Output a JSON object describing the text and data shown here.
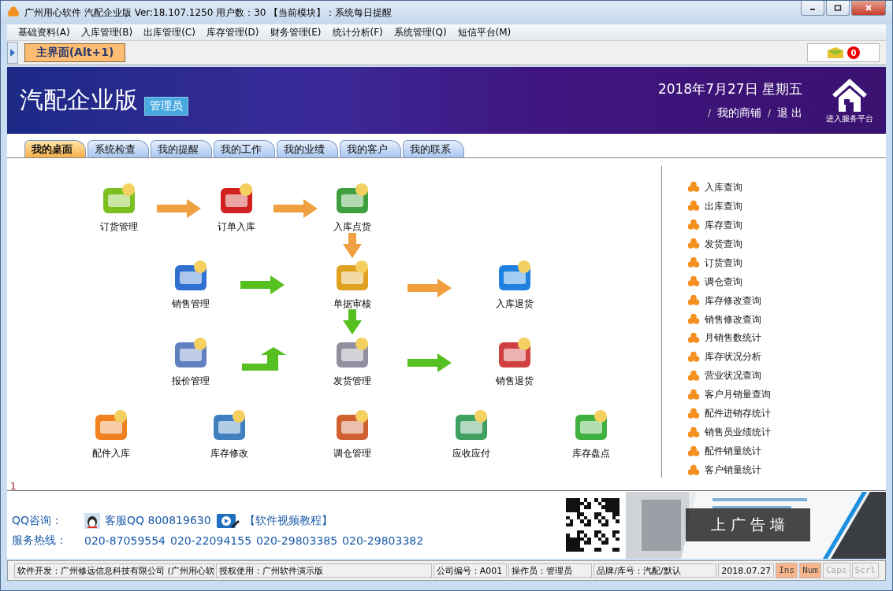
{
  "window": {
    "title": "广州用心软件 汽配企业版  Ver:18.107.1250  用户数：30  【当前模块】：系统每日提醒"
  },
  "menu": [
    "基础资料(A)",
    "入库管理(B)",
    "出库管理(C)",
    "库存管理(D)",
    "财务管理(E)",
    "统计分析(F)",
    "系统管理(Q)",
    "短信平台(M)"
  ],
  "toolbar": {
    "tab": "主界面(Alt+1)",
    "badge": "0"
  },
  "banner": {
    "title": "汽配企业版",
    "role": "管理员",
    "date": "2018年7月27日 星期五",
    "links": [
      "我的商铺",
      "退 出"
    ],
    "service": "进入服务平台"
  },
  "tabs": [
    {
      "label": "我的桌面",
      "selected": true
    },
    {
      "label": "系统检查",
      "selected": false
    },
    {
      "label": "我的提醒",
      "selected": false
    },
    {
      "label": "我的工作",
      "selected": false
    },
    {
      "label": "我的业绩",
      "selected": false
    },
    {
      "label": "我的客户",
      "selected": false
    },
    {
      "label": "我的联系",
      "selected": false
    }
  ],
  "flow": [
    "订货管理",
    "订单入库",
    "入库点货",
    "销售管理",
    "单据审核",
    "入库退货",
    "报价管理",
    "发货管理",
    "销售退货",
    "配件入库",
    "库存修改",
    "调仓管理",
    "应收应付",
    "库存盘点"
  ],
  "quick_links": [
    "入库查询",
    "出库查询",
    "库存查询",
    "发货查询",
    "订货查询",
    "调仓查询",
    "库存修改查询",
    "销售修改查询",
    "月销售数统计",
    "库存状况分析",
    "营业状况查询",
    "客户月销量查询",
    "配件进销存统计",
    "销售员业绩统计",
    "配件销量统计",
    "客户销量统计"
  ],
  "page_marker": "1",
  "contact": {
    "qq_label": "QQ咨询：",
    "qq": "客服QQ 800819630",
    "video": "【软件视频教程】",
    "hotline_label": "服务热线：",
    "phones": [
      "020-87059554",
      "020-22094155",
      "020-29803385",
      "020-29803382"
    ],
    "ad": "上 广 告 墙"
  },
  "status_bar": [
    {
      "text": "软件开发：广州修远信息科技有限公司 (广州用心软"
    },
    {
      "text": "授权使用：广州软件演示版"
    },
    {
      "text": "公司编号：A001"
    },
    {
      "text": "操作员：管理员"
    },
    {
      "text": "品牌/库号：汽配/默认"
    },
    {
      "text": "2018.07.27"
    }
  ],
  "keys": [
    {
      "label": "Ins",
      "on": true
    },
    {
      "label": "Num",
      "on": true
    },
    {
      "label": "Caps",
      "on": false
    },
    {
      "label": "Scrl",
      "on": false
    }
  ]
}
